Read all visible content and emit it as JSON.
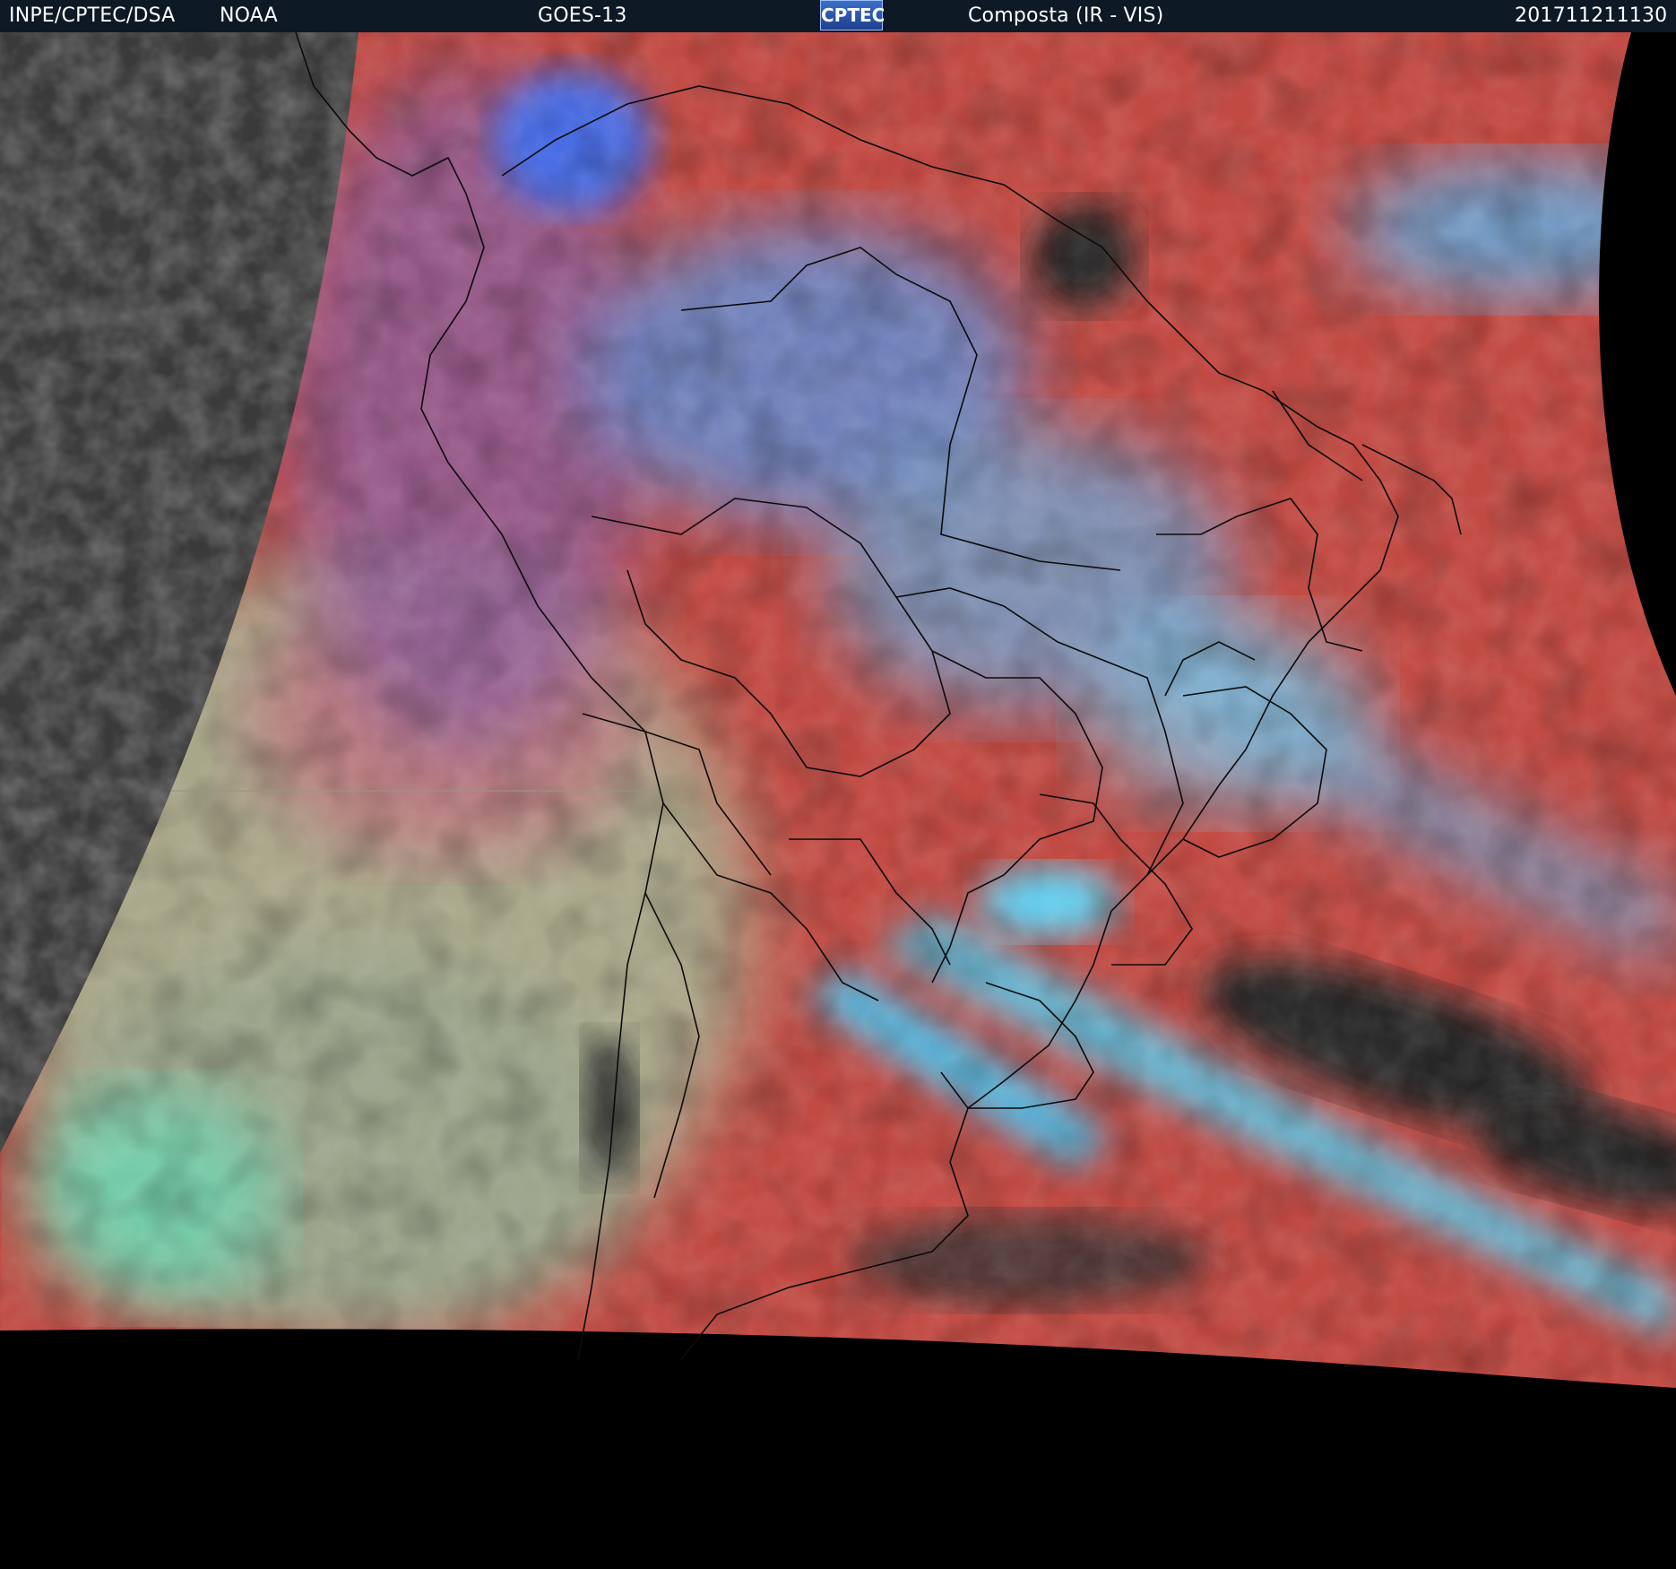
{
  "header": {
    "agency": "INPE/CPTEC/DSA",
    "source": "NOAA",
    "satellite": "GOES-13",
    "logo_text": "CPTEC",
    "product": "Composta (IR - VIS)",
    "timestamp": "201711211130"
  },
  "colors": {
    "header_bg": "#0d1a26",
    "space": "#000000",
    "ocean_night_ir": "#3c3c3c",
    "land_warm_red": "#c8463c",
    "cold_cloud_cyan": "#5ac8e6",
    "deep_convection_blue": "#3c78ff",
    "stratus_yellowgreen": "#a8aa8c",
    "clear_dark": "#282828",
    "borders": "#000000"
  }
}
